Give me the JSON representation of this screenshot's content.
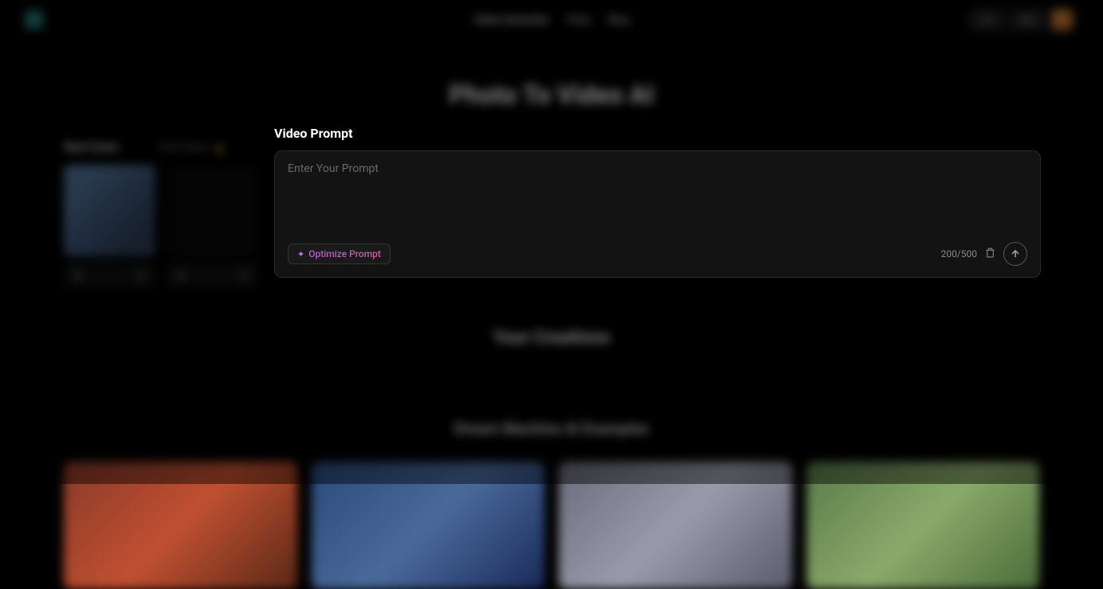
{
  "header": {
    "nav": {
      "primary": "Video Generator",
      "price": "Price",
      "blog": "Blog"
    },
    "right": {
      "btn1": "Lite",
      "btn2": "Buy"
    }
  },
  "page_title": "Photo To Video AI",
  "frames": {
    "start_label": "Start Frame",
    "end_label": "End Frame"
  },
  "prompt": {
    "title": "Video Prompt",
    "placeholder": "Enter Your Prompt",
    "optimize_label": "Optimize Prompt",
    "char_count": "200/500"
  },
  "sections": {
    "creations": "Your Creations",
    "examples": "Dream Machine AI Examples"
  }
}
